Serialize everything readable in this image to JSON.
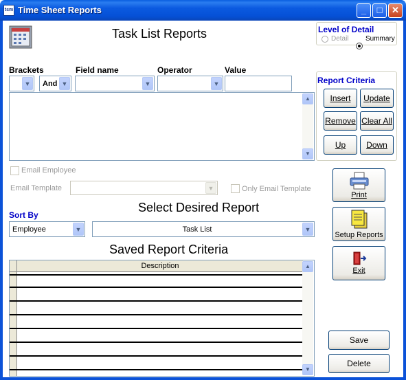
{
  "window": {
    "icon_text": "tsm",
    "title": "Time Sheet Reports",
    "minimize": "_",
    "maximize": "□",
    "close": "✕"
  },
  "header": {
    "title": "Task List Reports",
    "icon": "report-calendar-icon"
  },
  "level_of_detail": {
    "label": "Level of Detail",
    "options": [
      {
        "label": "Detail",
        "selected": false,
        "enabled": false
      },
      {
        "label": "Summary",
        "selected": true,
        "enabled": true
      }
    ]
  },
  "criteria": {
    "columns": {
      "brackets": "Brackets",
      "field_name": "Field name",
      "operator": "Operator",
      "value": "Value"
    },
    "logic_value": "And"
  },
  "report_criteria": {
    "label": "Report Criteria",
    "buttons": {
      "insert": "Insert",
      "update": "Update",
      "remove": "Remove",
      "clear_all": "Clear All",
      "up": "Up",
      "down": "Down"
    }
  },
  "email": {
    "email_employee": "Email Employee",
    "email_template": "Email Template",
    "only_email_template": "Only Email Template"
  },
  "sort_by": {
    "label": "Sort By",
    "value": "Employee"
  },
  "select_report": {
    "title": "Select Desired Report",
    "value": "Task List"
  },
  "saved": {
    "title": "Saved Report Criteria",
    "column": "Description",
    "row_count": 7
  },
  "actions": {
    "print": "Print",
    "setup_reports": "Setup Reports",
    "exit": "Exit",
    "save": "Save",
    "delete": "Delete"
  },
  "colors": {
    "titlebar": "#0b52d8",
    "accent_label": "#0000c8",
    "disabled_text": "#9a9a9a"
  }
}
